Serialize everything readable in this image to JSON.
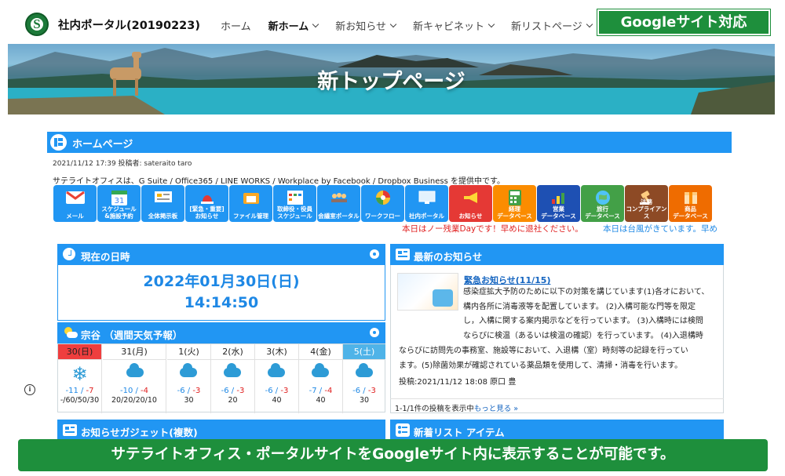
{
  "header": {
    "logo_letter": "S",
    "site_title": "社内ポータル(20190223)",
    "nav": [
      {
        "label": "ホーム",
        "dropdown": false,
        "active": false
      },
      {
        "label": "新ホーム",
        "dropdown": true,
        "active": true
      },
      {
        "label": "新お知らせ",
        "dropdown": true,
        "active": false
      },
      {
        "label": "新キャビネット",
        "dropdown": true,
        "active": false
      },
      {
        "label": "新リストページ",
        "dropdown": true,
        "active": false
      }
    ],
    "badge": "Googleサイト対応"
  },
  "hero": {
    "title": "新トップページ"
  },
  "homepage": {
    "header_label": "ホームページ",
    "post_meta": "2021/11/12 17:39 投稿者: sateraito taro",
    "intro": "サテライトオフィスは、G Suite / Office365 / LINE WORKS / Workplace by Facebook / Dropbox Business を提供中です。"
  },
  "apps": [
    {
      "label": "メール",
      "icon": "gmail-icon",
      "color": "#2196f3"
    },
    {
      "label": "スケジュール\n&施設予約",
      "icon": "calendar-icon",
      "color": "#2196f3"
    },
    {
      "label": "全体掲示板",
      "icon": "bulletin-board-icon",
      "color": "#2196f3"
    },
    {
      "label": "[緊急・重要]\nお知らせ",
      "icon": "alert-siren-icon",
      "color": "#2196f3"
    },
    {
      "label": "ファイル管理",
      "icon": "file-folder-icon",
      "color": "#2196f3"
    },
    {
      "label": "取締役・役員\nスケジュール",
      "icon": "executive-calendar-icon",
      "color": "#2196f3"
    },
    {
      "label": "会議室ポータル",
      "icon": "meeting-room-icon",
      "color": "#2196f3"
    },
    {
      "label": "ワークフロー",
      "icon": "workflow-icon",
      "color": "#2196f3"
    },
    {
      "label": "社内ポータル",
      "icon": "portal-monitor-icon",
      "color": "#2196f3"
    },
    {
      "label": "お知らせ",
      "icon": "megaphone-icon",
      "color": "#e53935"
    },
    {
      "label": "経理\nデータベース",
      "icon": "calculator-icon",
      "color": "#fb8c00"
    },
    {
      "label": "営業\nデータベース",
      "icon": "sales-chart-icon",
      "color": "#1e50b3"
    },
    {
      "label": "旅行\nデータベース",
      "icon": "globe-travel-icon",
      "color": "#43a047"
    },
    {
      "label": "法務\nコンプライアンス",
      "icon": "gavel-icon",
      "color": "#8d4a25"
    },
    {
      "label": "商品\nデータベース",
      "icon": "product-box-icon",
      "color": "#ef6c00"
    }
  ],
  "tickers": {
    "left": "本日はノー残業Dayです！早めに退社ください。",
    "right": "本日は台風がきています。早め"
  },
  "datetime": {
    "panel_title": "現在の日時",
    "date": "2022年01月30日(日)",
    "time": "14:14:50"
  },
  "weather": {
    "panel_title": "宗谷 （週間天気予報）",
    "days": [
      {
        "day": "30(日)",
        "type": "sun",
        "icon": "snow-icon",
        "low": "-11",
        "high": "-7",
        "pop": "-/60/50/30"
      },
      {
        "day": "31(月)",
        "type": "weekday",
        "icon": "cloud-icon",
        "low": "-10",
        "high": "-4",
        "pop": "20/20/20/10"
      },
      {
        "day": "1(火)",
        "type": "weekday",
        "icon": "cloud-icon",
        "low": "-6",
        "high": "-3",
        "pop": "30"
      },
      {
        "day": "2(水)",
        "type": "weekday",
        "icon": "cloud-icon",
        "low": "-6",
        "high": "-3",
        "pop": "20"
      },
      {
        "day": "3(木)",
        "type": "weekday",
        "icon": "cloud-icon",
        "low": "-6",
        "high": "-3",
        "pop": "40"
      },
      {
        "day": "4(金)",
        "type": "weekday",
        "icon": "cloud-icon",
        "low": "-7",
        "high": "-4",
        "pop": "40"
      },
      {
        "day": "5(土)",
        "type": "sat",
        "icon": "cloud-icon",
        "low": "-6",
        "high": "-3",
        "pop": "30"
      }
    ]
  },
  "news": {
    "panel_title": "最新のお知らせ",
    "title": "緊急お知らせ(11/15)",
    "body_lines": [
      "感染症拡大予防のために以下の対策を講じています(1)各オにおいて、",
      "構内各所に消毒液等を配置しています。 (2)入構可能な門等を限定",
      "し，入構に関する案内掲示などを行っています。 (3)入構時には検問",
      "ならびに検温（あるいは検温の確認）を行っています。 (4)入退構時",
      "ならびに訪問先の事務室、施設等において、入退構（室）時刻等の記録を行ってい",
      "ます。(5)除菌効果が確認されている薬品類を使用して、清掃・消毒を行います。"
    ],
    "meta": "投稿:2021/11/12 18:08 原口 豊",
    "footer_count": "1-1/1件の投稿を表示中",
    "footer_link": "もっと見る »"
  },
  "gadget": {
    "panel_title": "お知らせガジェット(複数)"
  },
  "newlist": {
    "panel_title": "新着リスト アイテム"
  },
  "bottom_banner": "サテライトオフィス・ポータルサイトをGoogleサイト内に表示することが可能です。"
}
